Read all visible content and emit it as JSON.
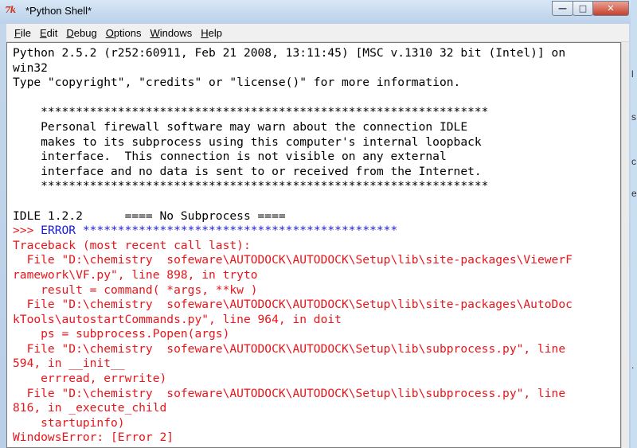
{
  "window": {
    "title": "*Python Shell*",
    "icon_text": "7k",
    "controls": {
      "minimize": "—",
      "maximize": "□",
      "close": "✕"
    }
  },
  "menu": [
    {
      "underline": "F",
      "rest": "ile"
    },
    {
      "underline": "E",
      "rest": "dit"
    },
    {
      "underline": "D",
      "rest": "ebug"
    },
    {
      "underline": "O",
      "rest": "ptions"
    },
    {
      "underline": "W",
      "rest": "indows"
    },
    {
      "underline": "H",
      "rest": "elp"
    }
  ],
  "lines": [
    {
      "text": "Python 2.5.2 (r252:60911, Feb 21 2008, 13:11:45) [MSC v.1310 32 bit (Intel)] on",
      "color": "black"
    },
    {
      "text": "win32",
      "color": "black"
    },
    {
      "text": "Type \"copyright\", \"credits\" or \"license()\" for more information.",
      "color": "black"
    },
    {
      "text": "",
      "color": "black"
    },
    {
      "text": "    ****************************************************************",
      "color": "black"
    },
    {
      "text": "    Personal firewall software may warn about the connection IDLE",
      "color": "black"
    },
    {
      "text": "    makes to its subprocess using this computer's internal loopback",
      "color": "black"
    },
    {
      "text": "    interface.  This connection is not visible on any external",
      "color": "black"
    },
    {
      "text": "    interface and no data is sent to or received from the Internet.",
      "color": "black"
    },
    {
      "text": "    ****************************************************************",
      "color": "black"
    },
    {
      "text": "",
      "color": "black"
    },
    {
      "text": "IDLE 1.2.2      ==== No Subprocess ====",
      "color": "black"
    },
    {
      "prompt": ">>> ",
      "text": "ERROR *********************************************",
      "color": "blue"
    },
    {
      "text": "Traceback (most recent call last):",
      "color": "red"
    },
    {
      "text": "  File \"D:\\chemistry  sofeware\\AUTODOCK\\AUTODOCK\\Setup\\lib\\site-packages\\ViewerF",
      "color": "red"
    },
    {
      "text": "ramework\\VF.py\", line 898, in tryto",
      "color": "red"
    },
    {
      "text": "    result = command( *args, **kw )",
      "color": "red"
    },
    {
      "text": "  File \"D:\\chemistry  sofeware\\AUTODOCK\\AUTODOCK\\Setup\\lib\\site-packages\\AutoDoc",
      "color": "red"
    },
    {
      "text": "kTools\\autostartCommands.py\", line 964, in doit",
      "color": "red"
    },
    {
      "text": "    ps = subprocess.Popen(args)",
      "color": "red"
    },
    {
      "text": "  File \"D:\\chemistry  sofeware\\AUTODOCK\\AUTODOCK\\Setup\\lib\\subprocess.py\", line",
      "color": "red"
    },
    {
      "text": "594, in __init__",
      "color": "red"
    },
    {
      "text": "    errread, errwrite)",
      "color": "red"
    },
    {
      "text": "  File \"D:\\chemistry  sofeware\\AUTODOCK\\AUTODOCK\\Setup\\lib\\subprocess.py\", line",
      "color": "red"
    },
    {
      "text": "816, in _execute_child",
      "color": "red"
    },
    {
      "text": "    startupinfo)",
      "color": "red"
    },
    {
      "text": "WindowsError: [Error 2]",
      "color": "red"
    }
  ],
  "edge_chars": [
    "l",
    "s",
    "c",
    "e",
    "."
  ],
  "colors": {
    "prompt": "#e8151b",
    "error_banner": "#1a1adf",
    "traceback": "#e8151b",
    "close_button": "#c7402c"
  }
}
